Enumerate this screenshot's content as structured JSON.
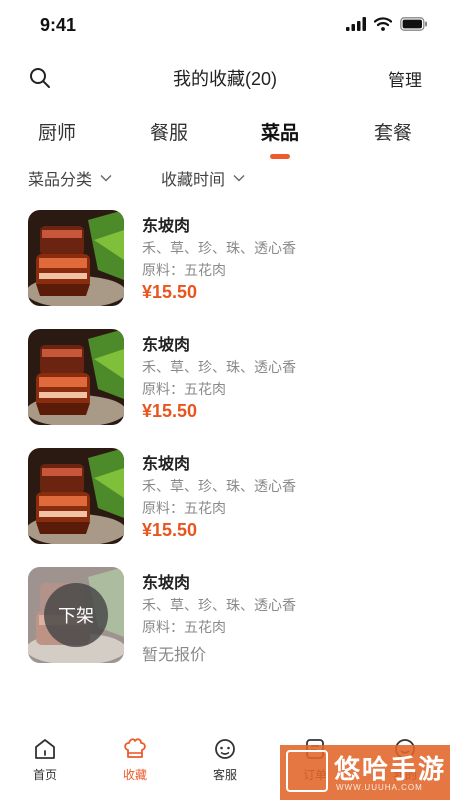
{
  "status": {
    "time": "9:41"
  },
  "nav": {
    "title": "我的收藏(20)",
    "manage_label": "管理"
  },
  "tabs": [
    {
      "label": "厨师",
      "active": false
    },
    {
      "label": "餐服",
      "active": false
    },
    {
      "label": "菜品",
      "active": true
    },
    {
      "label": "套餐",
      "active": false
    }
  ],
  "filters": {
    "category": "菜品分类",
    "time": "收藏时间"
  },
  "items": [
    {
      "name": "东坡肉",
      "desc": "禾、草、珍、珠、透心香",
      "ingredients": "原料：五花肉",
      "price": "¥15.50",
      "off_shelf": false
    },
    {
      "name": "东坡肉",
      "desc": "禾、草、珍、珠、透心香",
      "ingredients": "原料：五花肉",
      "price": "¥15.50",
      "off_shelf": false
    },
    {
      "name": "东坡肉",
      "desc": "禾、草、珍、珠、透心香",
      "ingredients": "原料：五花肉",
      "price": "¥15.50",
      "off_shelf": false
    },
    {
      "name": "东坡肉",
      "desc": "禾、草、珍、珠、透心香",
      "ingredients": "原料：五花肉",
      "price": "暂无报价",
      "off_shelf": true,
      "off_shelf_label": "下架"
    }
  ],
  "tabbar": [
    {
      "label": "首页",
      "icon": "home-icon",
      "active": false
    },
    {
      "label": "收藏",
      "icon": "chef-hat-icon",
      "active": true
    },
    {
      "label": "客服",
      "icon": "customer-service-icon",
      "active": false
    },
    {
      "label": "订单",
      "icon": "order-icon",
      "active": false
    },
    {
      "label": "我的",
      "icon": "profile-icon",
      "active": false
    }
  ],
  "watermark": {
    "text": "悠哈手游",
    "sub": "WWW.UUUHA.COM"
  },
  "colors": {
    "accent": "#ee5a2b",
    "price": "#e8551f",
    "muted": "#8a8a8a"
  }
}
